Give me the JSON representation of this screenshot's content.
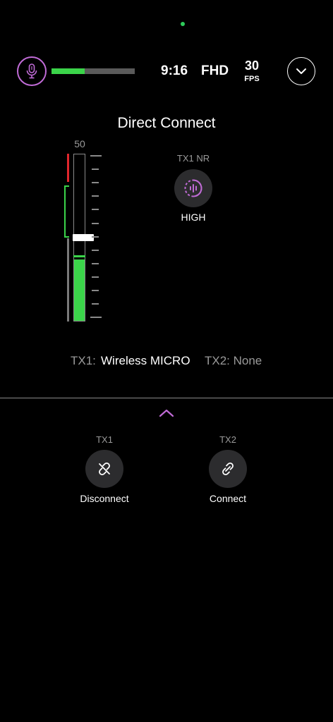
{
  "status": {
    "record_level_fraction": 0.4,
    "time": "9:16",
    "resolution": "FHD",
    "frame_rate": "30",
    "frame_rate_unit": "FPS"
  },
  "title": "Direct Connect",
  "meter": {
    "max_label": "50",
    "level_fraction": 0.37,
    "handle_fraction": 0.5
  },
  "noise_reduction": {
    "label": "TX1 NR",
    "value": "HIGH"
  },
  "devices": {
    "tx1_prefix": "TX1:",
    "tx1_name": "Wireless MICRO",
    "tx2_text": "TX2: None"
  },
  "slots": [
    {
      "label": "TX1",
      "action": "Disconnect"
    },
    {
      "label": "TX2",
      "action": "Connect"
    }
  ],
  "colors": {
    "accent": "#c06bd6",
    "meter_green": "#3bd44a",
    "peak_red": "#e0262c"
  }
}
